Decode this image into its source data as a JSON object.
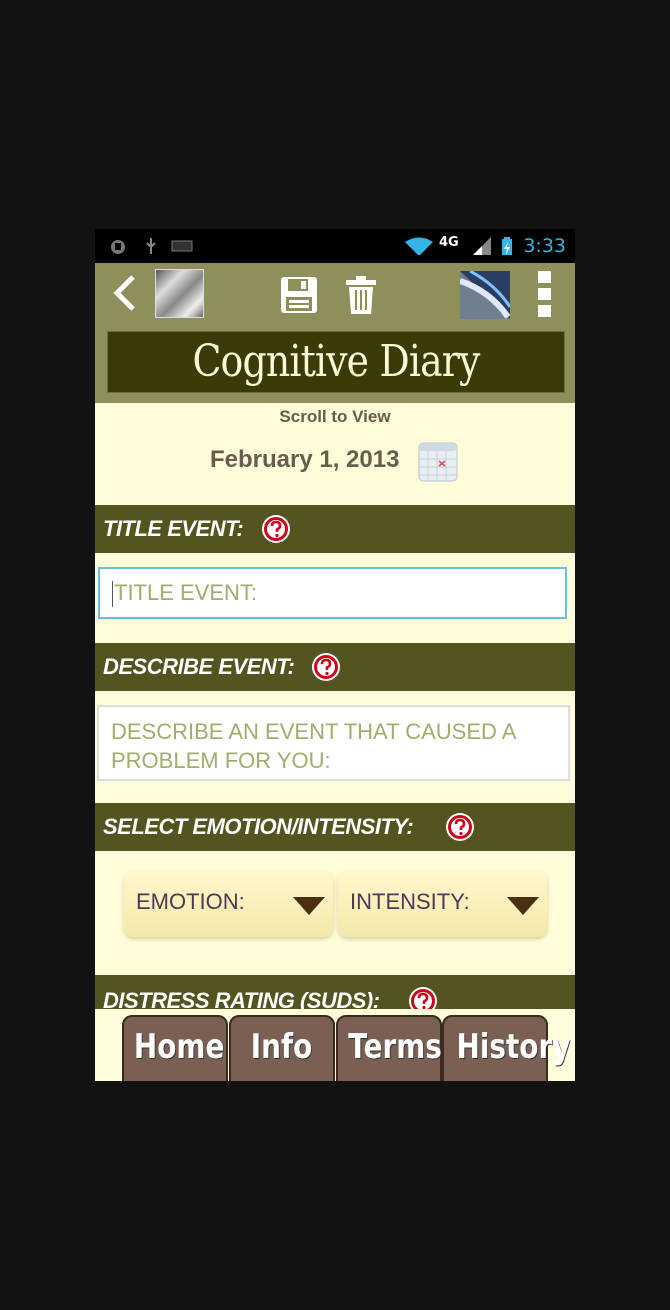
{
  "status_bar": {
    "network": "4G",
    "time": "3:33",
    "icons": [
      "android-debug-icon",
      "usb-icon",
      "notification-icon",
      "wifi-icon",
      "signal-icon",
      "battery-charging-icon"
    ]
  },
  "action_bar": {
    "icons": [
      "back-chevron-icon",
      "avatar-photo",
      "save-icon",
      "trash-icon",
      "app-logo-icon",
      "overflow-menu-icon"
    ]
  },
  "banner": {
    "title": "Cognitive Diary"
  },
  "scroll_note": "Scroll to View",
  "date": {
    "text": "February 1, 2013",
    "icon": "calendar-icon"
  },
  "sections": {
    "title": {
      "label": "TITLE EVENT:",
      "placeholder": "TITLE EVENT:"
    },
    "describe": {
      "label": "DESCRIBE EVENT:",
      "placeholder": "DESCRIBE AN EVENT THAT CAUSED A PROBLEM FOR YOU:"
    },
    "emotion": {
      "label": "SELECT EMOTION/INTENSITY:",
      "emotion_dropdown": "EMOTION:",
      "intensity_dropdown": "INTENSITY:"
    },
    "distress": {
      "label": "DISTRESS RATING (SUDS):"
    }
  },
  "tabs": [
    "Home",
    "Info",
    "Terms",
    "History"
  ],
  "colors": {
    "section_header": "#545420",
    "background": "#fffcd9",
    "banner": "#3a3b06",
    "tab": "#7a5f52",
    "help_icon": "#d0021b",
    "clock": "#35b5e5"
  }
}
